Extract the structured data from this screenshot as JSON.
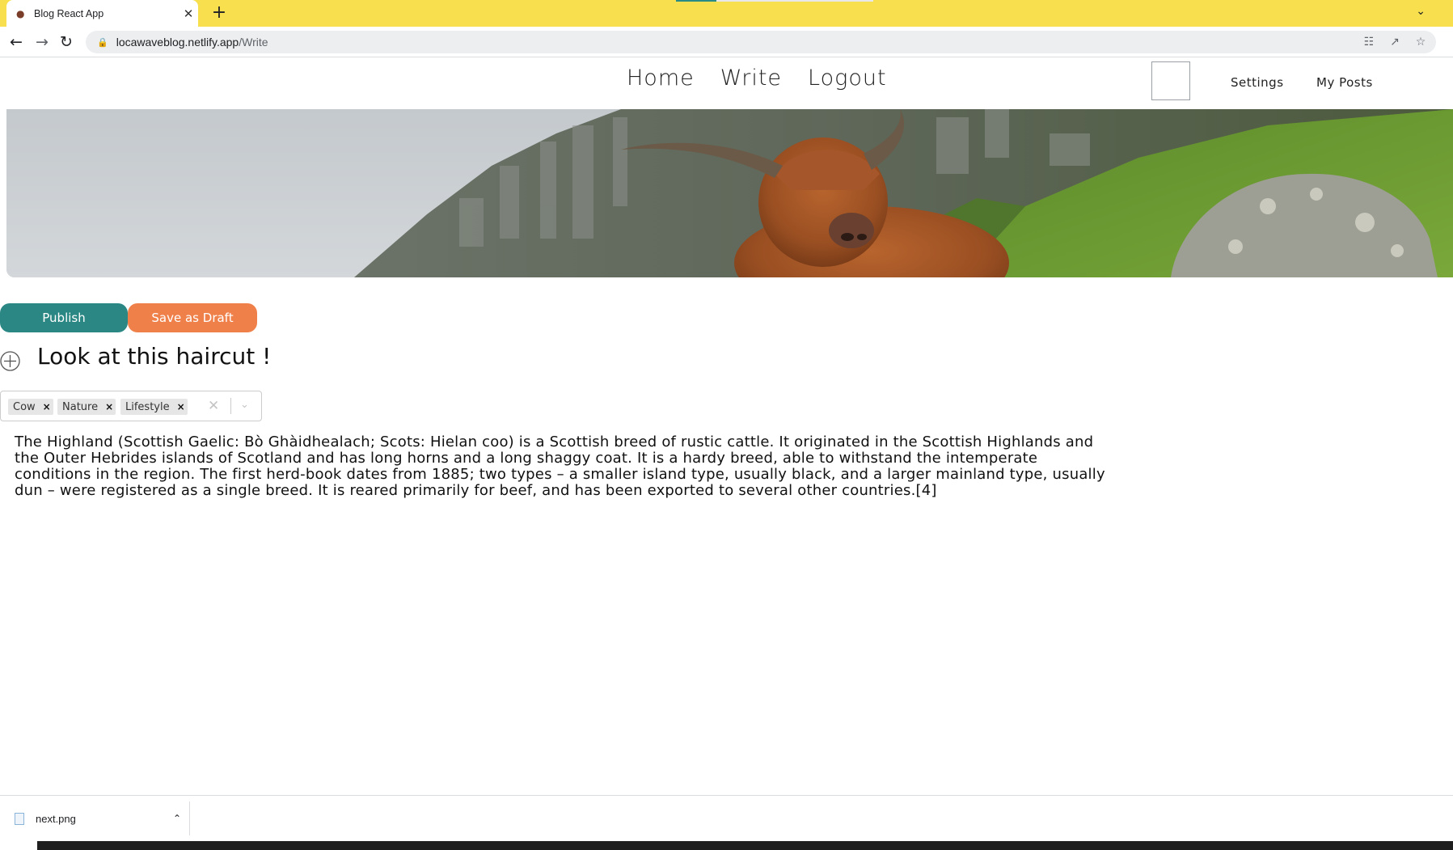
{
  "browser": {
    "tab_title": "Blog React App",
    "new_tab_label": "+",
    "url_host": "locawaveblog.netlify.app",
    "url_path": "/Write"
  },
  "nav": {
    "home": "Home",
    "write": "Write",
    "logout": "Logout",
    "settings": "Settings",
    "my_posts": "My Posts"
  },
  "actions": {
    "publish": "Publish",
    "save_draft": "Save as Draft"
  },
  "post": {
    "title": "Look at this haircut !",
    "tags": [
      "Cow",
      "Nature",
      "Lifestyle"
    ],
    "body": "The Highland (Scottish Gaelic: Bò Ghàidhealach; Scots: Hielan coo) is a Scottish breed of rustic cattle. It originated in the Scottish Highlands and the Outer Hebrides islands of Scotland and has long horns and a long shaggy coat. It is a hardy breed, able to withstand the intemperate conditions in the region. The first herd-book dates from 1885; two types – a smaller island type, usually black, and a larger mainland type, usually dun – were registered as a single breed. It is reared primarily for beef, and has been exported to several other countries.[4]"
  },
  "downloads": {
    "file_name": "next.png"
  },
  "colors": {
    "tabbar": "#f7df4e",
    "publish": "#2a8783",
    "draft": "#f0804a"
  }
}
